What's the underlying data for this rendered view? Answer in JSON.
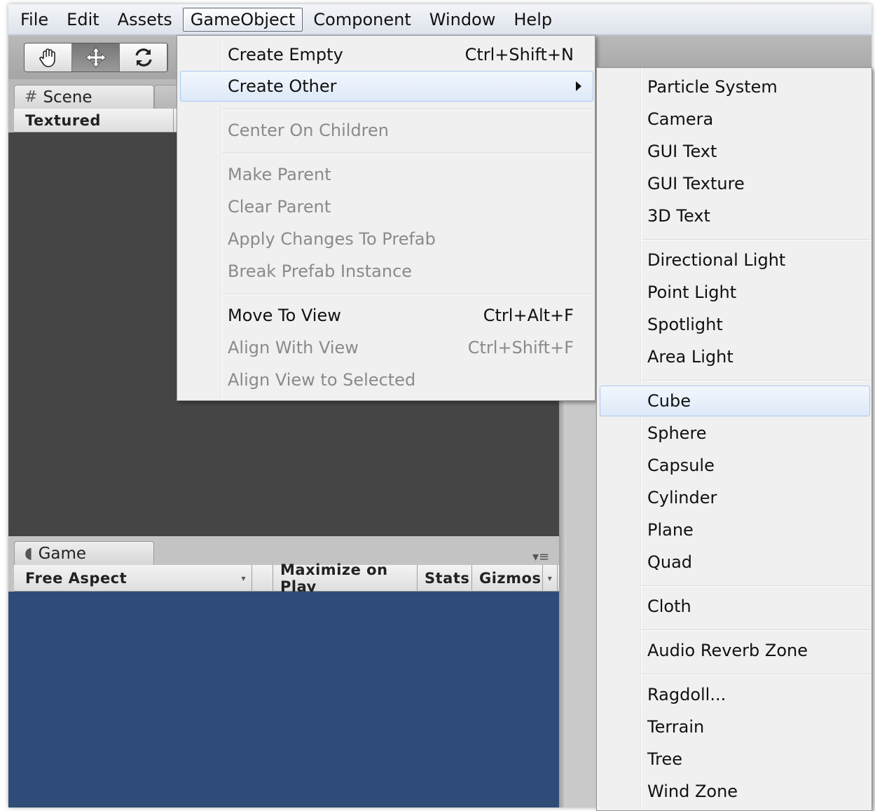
{
  "menubar": {
    "items": [
      {
        "label": "File"
      },
      {
        "label": "Edit"
      },
      {
        "label": "Assets"
      },
      {
        "label": "GameObject"
      },
      {
        "label": "Component"
      },
      {
        "label": "Window"
      },
      {
        "label": "Help"
      }
    ],
    "open_index": 3
  },
  "toolbar": {
    "tools": [
      "hand-icon",
      "move-icon",
      "rotate-icon"
    ],
    "active_tool": "move-icon"
  },
  "scene": {
    "tab_label": "Scene",
    "tab_icon": "grid-icon",
    "render_mode": "Textured"
  },
  "game": {
    "tab_label": "Game",
    "tab_icon": "pacman-icon",
    "aspect": "Free Aspect",
    "maximize": "Maximize on Play",
    "stats": "Stats",
    "gizmos": "Gizmos"
  },
  "gameobject_menu": {
    "items": [
      {
        "label": "Create Empty",
        "shortcut": "Ctrl+Shift+N"
      },
      {
        "label": "Create Other",
        "submenu_arrow": "triangle-right-icon"
      },
      {
        "label": "Center On Children"
      },
      {
        "label": "Make Parent"
      },
      {
        "label": "Clear Parent"
      },
      {
        "label": "Apply Changes To Prefab"
      },
      {
        "label": "Break Prefab Instance"
      },
      {
        "label": "Move To View",
        "shortcut": "Ctrl+Alt+F"
      },
      {
        "label": "Align With View",
        "shortcut": "Ctrl+Shift+F"
      },
      {
        "label": "Align View to Selected"
      }
    ]
  },
  "create_other_menu": {
    "items": [
      {
        "label": "Particle System"
      },
      {
        "label": "Camera"
      },
      {
        "label": "GUI Text"
      },
      {
        "label": "GUI Texture"
      },
      {
        "label": "3D Text"
      },
      {
        "label": "Directional Light"
      },
      {
        "label": "Point Light"
      },
      {
        "label": "Spotlight"
      },
      {
        "label": "Area Light"
      },
      {
        "label": "Cube"
      },
      {
        "label": "Sphere"
      },
      {
        "label": "Capsule"
      },
      {
        "label": "Cylinder"
      },
      {
        "label": "Plane"
      },
      {
        "label": "Quad"
      },
      {
        "label": "Cloth"
      },
      {
        "label": "Audio Reverb Zone"
      },
      {
        "label": "Ragdoll..."
      },
      {
        "label": "Terrain"
      },
      {
        "label": "Tree"
      },
      {
        "label": "Wind Zone"
      }
    ]
  },
  "colors": {
    "scene_view": "#454545",
    "game_view": "#2f4c78",
    "menu_bg": "#f0f0f0",
    "highlight_border": "#a8c8ee"
  }
}
